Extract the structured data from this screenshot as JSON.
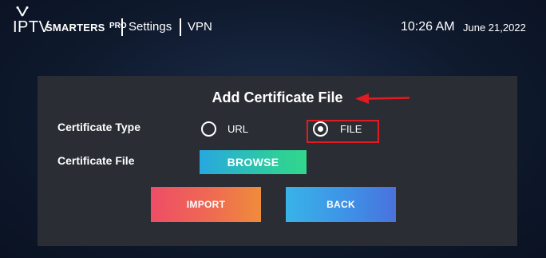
{
  "header": {
    "logo": {
      "iptv": "IPTV",
      "smarters": "SMARTERS",
      "pro": "PRO",
      "icon": "tv-antenna-icon"
    },
    "breadcrumb": [
      "Settings",
      "VPN"
    ],
    "time": "10:26 AM",
    "date": "June 21,2022"
  },
  "dialog": {
    "title": "Add Certificate File",
    "certificate_type_label": "Certificate Type",
    "certificate_type_options": [
      {
        "label": "URL",
        "selected": false
      },
      {
        "label": "FILE",
        "selected": true
      }
    ],
    "certificate_file_label": "Certificate File",
    "browse_label": "BROWSE",
    "import_label": "IMPORT",
    "back_label": "BACK"
  },
  "annotations": {
    "highlight_color": "#e21b23",
    "arrow_color": "#e21b23",
    "arrow_icon": "arrow-left-icon"
  },
  "colors": {
    "panel_bg": "#2a2d33",
    "browse_gradient": [
      "#28a8e0",
      "#32d68e"
    ],
    "import_gradient": [
      "#ee4d66",
      "#ef8c3b"
    ],
    "back_gradient": [
      "#38b3e8",
      "#4a72dd"
    ]
  }
}
